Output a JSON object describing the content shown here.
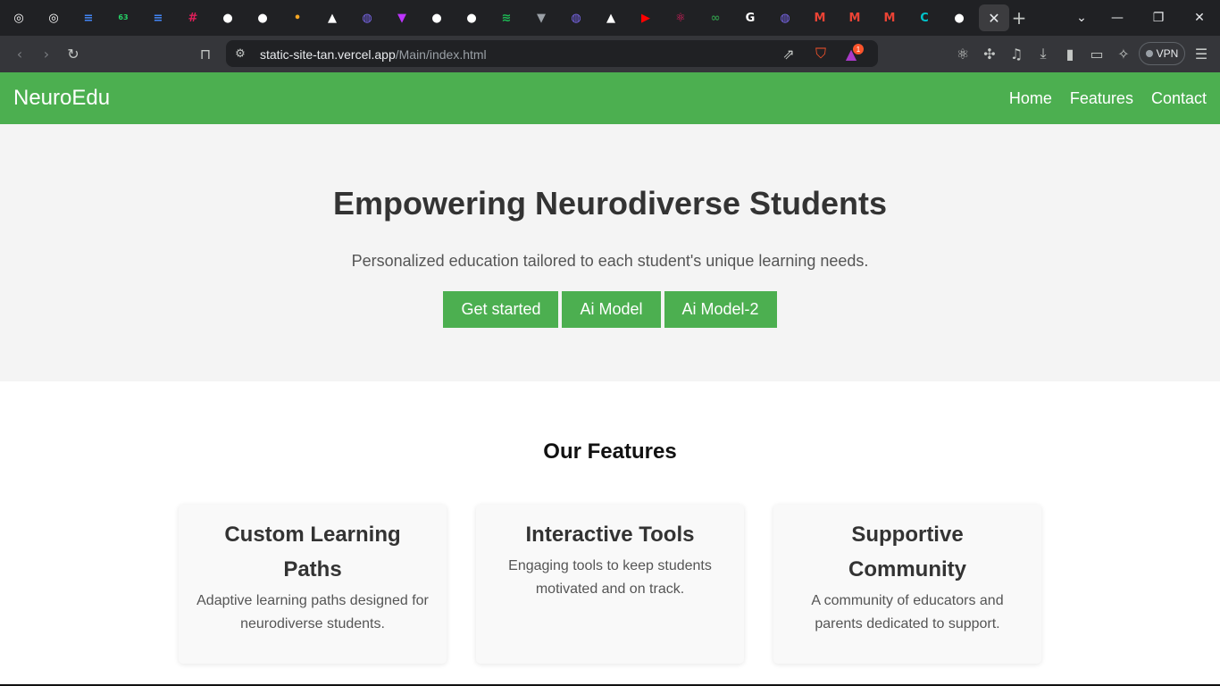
{
  "browser": {
    "tabs": [
      {
        "icon": "openai-icon",
        "color": "#ffffff",
        "glyph": "◎"
      },
      {
        "icon": "openai-icon",
        "color": "#ffffff",
        "glyph": "◎"
      },
      {
        "icon": "google-docs-icon",
        "color": "#4285f4",
        "glyph": "≡"
      },
      {
        "icon": "whatsapp-icon",
        "color": "#25d366",
        "glyph": "63"
      },
      {
        "icon": "google-docs-icon",
        "color": "#4285f4",
        "glyph": "≡"
      },
      {
        "icon": "slack-icon",
        "color": "#e01e5a",
        "glyph": "#"
      },
      {
        "icon": "github-icon",
        "color": "#ffffff",
        "glyph": "●"
      },
      {
        "icon": "github-icon",
        "color": "#ffffff",
        "glyph": "●"
      },
      {
        "icon": "colorful-dot-icon",
        "color": "#f5a623",
        "glyph": "•"
      },
      {
        "icon": "vercel-icon",
        "color": "#ffffff",
        "glyph": "▲"
      },
      {
        "icon": "globe-icon",
        "color": "#7b68ee",
        "glyph": "◍"
      },
      {
        "icon": "vite-icon",
        "color": "#bd34fe",
        "glyph": "▼"
      },
      {
        "icon": "github-icon",
        "color": "#ffffff",
        "glyph": "●"
      },
      {
        "icon": "github-icon",
        "color": "#ffffff",
        "glyph": "●"
      },
      {
        "icon": "spotify-icon",
        "color": "#1db954",
        "glyph": "≋"
      },
      {
        "icon": "vue-icon",
        "color": "#9aa0a6",
        "glyph": "▼"
      },
      {
        "icon": "globe-icon",
        "color": "#7b68ee",
        "glyph": "◍"
      },
      {
        "icon": "vercel-icon",
        "color": "#ffffff",
        "glyph": "▲"
      },
      {
        "icon": "youtube-icon",
        "color": "#ff0000",
        "glyph": "▶"
      },
      {
        "icon": "react-icon",
        "color": "#e91e63",
        "glyph": "⚛"
      },
      {
        "icon": "geeksforgeeks-icon",
        "color": "#2f8d46",
        "glyph": "∞"
      },
      {
        "icon": "google-icon",
        "color": "#ffffff",
        "glyph": "G"
      },
      {
        "icon": "globe-icon",
        "color": "#7b68ee",
        "glyph": "◍"
      },
      {
        "icon": "gmail-icon",
        "color": "#ea4335",
        "glyph": "M"
      },
      {
        "icon": "gmail-icon",
        "color": "#ea4335",
        "glyph": "M"
      },
      {
        "icon": "gmail-icon",
        "color": "#ea4335",
        "glyph": "M"
      },
      {
        "icon": "canva-icon",
        "color": "#00c4cc",
        "glyph": "C"
      },
      {
        "icon": "github-icon",
        "color": "#ffffff",
        "glyph": "●"
      },
      {
        "icon": "close-icon",
        "color": "#e8eaed",
        "glyph": "✕",
        "active": true
      }
    ],
    "address": {
      "domain": "static-site-tan.vercel.app",
      "path": "/Main/index.html"
    },
    "brave_rewards_count": "1",
    "vpn_label": "VPN"
  },
  "site": {
    "brand": "NeuroEdu",
    "nav": [
      "Home",
      "Features",
      "Contact"
    ],
    "accent": "#4caf50"
  },
  "hero": {
    "title": "Empowering Neurodiverse Students",
    "subtitle": "Personalized education tailored to each student's unique learning needs.",
    "buttons": [
      "Get started",
      "Ai Model",
      "Ai Model-2"
    ]
  },
  "features": {
    "title": "Our Features",
    "cards": [
      {
        "title": "Custom Learning Paths",
        "text": "Adaptive learning paths designed for neurodiverse students."
      },
      {
        "title": "Interactive Tools",
        "text": "Engaging tools to keep students motivated and on track."
      },
      {
        "title": "Supportive Community",
        "text": "A community of educators and parents dedicated to support."
      }
    ]
  }
}
